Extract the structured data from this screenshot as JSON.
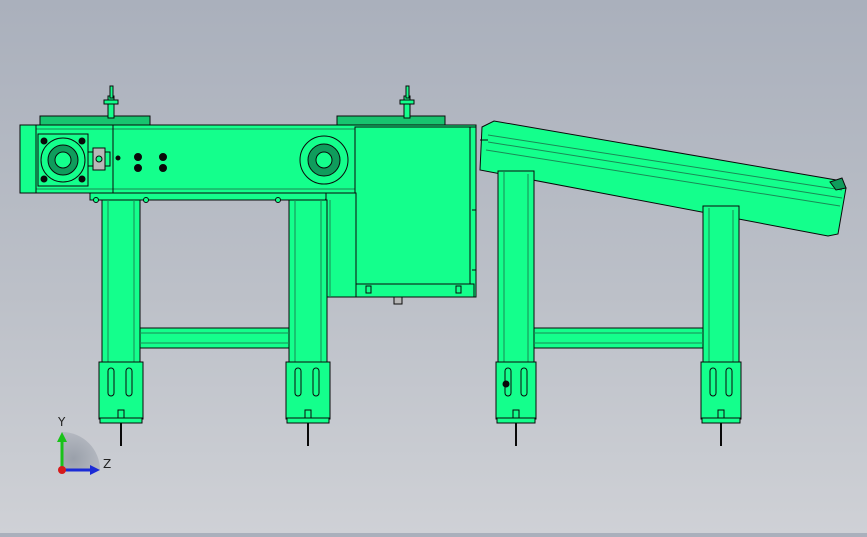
{
  "scene": {
    "description_free": true,
    "body_color": "#14ff8c",
    "outline_color": "#0a0a0a",
    "inner_line_color": "#1a8a55",
    "background_top": "#aab0bc",
    "background_bottom": "#cfd1d6"
  },
  "triad": {
    "y_label": "Y",
    "z_label": "Z",
    "y_axis_color": "#19c219",
    "z_axis_color": "#1b2bd6",
    "x_axis_color": "#d61b1b"
  }
}
